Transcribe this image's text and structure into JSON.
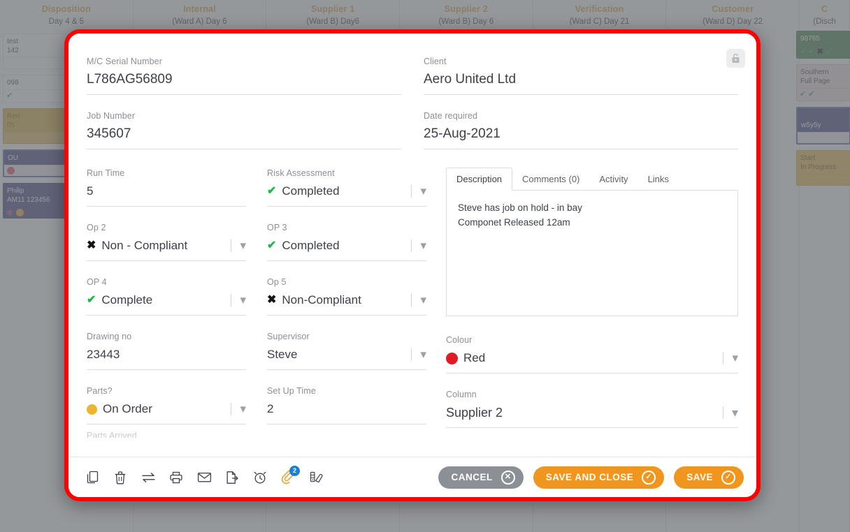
{
  "board": {
    "columns": [
      {
        "title": "Disposition",
        "subtitle": "Day 4 & 5"
      },
      {
        "title": "Internal",
        "subtitle": "(Ward A) Day 6"
      },
      {
        "title": "Supplier 1",
        "subtitle": "(Ward B) Day6"
      },
      {
        "title": "Supplier 2",
        "subtitle": "(Ward B) Day 6"
      },
      {
        "title": "Verification",
        "subtitle": "(Ward C) Day 21"
      },
      {
        "title": "Customer",
        "subtitle": "(Ward D) Day 22"
      },
      {
        "title": "C",
        "subtitle": "(Disch"
      }
    ],
    "left_cards": [
      {
        "line1": "test",
        "line2": "142"
      },
      {
        "line1": "098",
        "line2": ""
      },
      {
        "line1": "Red",
        "line2": "05"
      },
      {
        "line1": "OU",
        "line2": ""
      },
      {
        "line1": "Philip",
        "line2": "AM11 123456"
      }
    ],
    "right_cards": [
      {
        "line1": "98765",
        "line2": ""
      },
      {
        "line1": "Southern",
        "line2": "Full Page"
      },
      {
        "line1": "w5y5y",
        "line2": ""
      },
      {
        "line1": "Start",
        "line2": "In Progress"
      }
    ]
  },
  "modal": {
    "lock_icon": "lock-icon",
    "fields": {
      "mc_serial": {
        "label": "M/C Serial Number",
        "value": "L786AG56809"
      },
      "client": {
        "label": "Client",
        "value": "Aero United Ltd"
      },
      "job_number": {
        "label": "Job Number",
        "value": "345607"
      },
      "date_required": {
        "label": "Date required",
        "value": "25-Aug-2021"
      },
      "run_time": {
        "label": "Run Time",
        "value": "5"
      },
      "risk_assessment": {
        "label": "Risk Assessment",
        "value": "Completed",
        "icon": "tick"
      },
      "op2": {
        "label": "Op 2",
        "value": "Non - Compliant",
        "icon": "cross"
      },
      "op3": {
        "label": "OP 3",
        "value": "Completed",
        "icon": "tick"
      },
      "op4": {
        "label": "OP 4",
        "value": "Complete",
        "icon": "tick"
      },
      "op5": {
        "label": "Op 5",
        "value": "Non-Compliant",
        "icon": "cross"
      },
      "drawing_no": {
        "label": "Drawing no",
        "value": "23443"
      },
      "supervisor": {
        "label": "Supervisor",
        "value": "Steve"
      },
      "parts": {
        "label": "Parts?",
        "value": "On Order",
        "icon": "amber-dot"
      },
      "set_up_time": {
        "label": "Set Up Time",
        "value": "2"
      },
      "cut_off_label": "Parts Arrived",
      "colour": {
        "label": "Colour",
        "value": "Red",
        "icon": "red-dot",
        "hex": "#e01b24"
      },
      "column": {
        "label": "Column",
        "value": "Supplier 2"
      }
    },
    "tabs": [
      {
        "label": "Description",
        "active": true
      },
      {
        "label": "Comments (0)",
        "active": false
      },
      {
        "label": "Activity",
        "active": false
      },
      {
        "label": "Links",
        "active": false
      }
    ],
    "description_lines": [
      "Steve has job on hold - in bay",
      "Componet Released 12am"
    ],
    "toolbar": [
      {
        "name": "copy-icon",
        "label": "Copy"
      },
      {
        "name": "delete-icon",
        "label": "Delete"
      },
      {
        "name": "transfer-icon",
        "label": "Transfer"
      },
      {
        "name": "print-icon",
        "label": "Print"
      },
      {
        "name": "email-icon",
        "label": "Email"
      },
      {
        "name": "export-icon",
        "label": "Export"
      },
      {
        "name": "alarm-icon",
        "label": "Reminder"
      },
      {
        "name": "attachment-icon",
        "label": "Attachments",
        "badge": "2"
      },
      {
        "name": "colour-picker-icon",
        "label": "Colour"
      }
    ],
    "buttons": {
      "cancel": "CANCEL",
      "save_and_close": "SAVE AND CLOSE",
      "save": "SAVE"
    },
    "accent_orange": "#f0951e",
    "accent_grey": "#8b9096",
    "outline_red": "#ff0000"
  }
}
